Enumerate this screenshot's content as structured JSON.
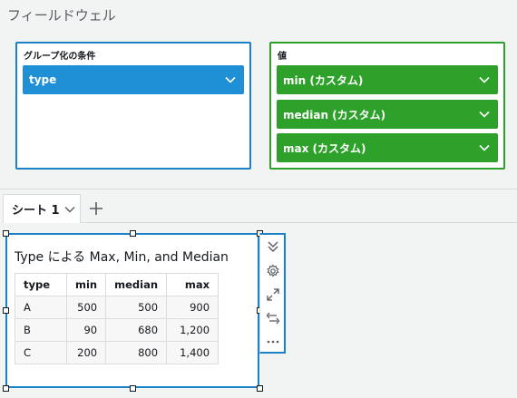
{
  "field_wells": {
    "title": "フィールドウェル",
    "group_by": {
      "label": "グループ化の条件",
      "fields": [
        {
          "label": "type"
        }
      ]
    },
    "values": {
      "label": "値",
      "fields": [
        {
          "label": "min (カスタム)"
        },
        {
          "label": "median (カスタム)"
        },
        {
          "label": "max (カスタム)"
        }
      ]
    },
    "colors": {
      "group": "#1f8fd6",
      "value": "#2ea12a",
      "selection": "#1b82c8"
    }
  },
  "sheets": {
    "tabs": [
      {
        "label": "シート 1"
      }
    ],
    "add_icon": "plus-icon"
  },
  "visual": {
    "title": "Type による Max, Min, and Median",
    "table": {
      "columns": [
        "type",
        "min",
        "median",
        "max"
      ],
      "rows": [
        [
          "A",
          "500",
          "500",
          "900"
        ],
        [
          "B",
          "90",
          "680",
          "1,200"
        ],
        [
          "C",
          "200",
          "800",
          "1,400"
        ]
      ]
    },
    "toolbar_icons": [
      "collapse-icon",
      "settings-icon",
      "expand-icon",
      "swap-icon",
      "more-icon"
    ]
  }
}
